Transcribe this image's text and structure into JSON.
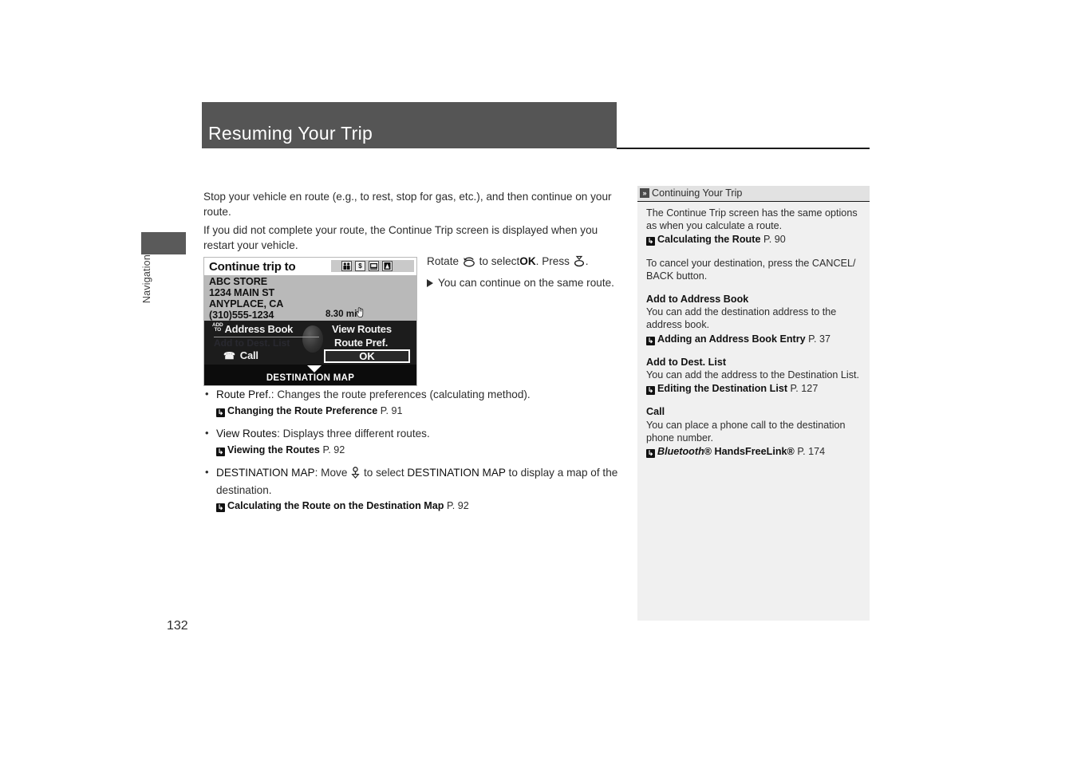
{
  "page": {
    "title": "Resuming Your Trip",
    "number": "132",
    "section_tab": "Navigation"
  },
  "main": {
    "paragraphs": [
      "Stop your vehicle en route (e.g., to rest, stop for gas, etc.), and then continue on your route.",
      "If you did not complete your route, the Continue Trip screen is displayed when you restart your vehicle."
    ],
    "callout": {
      "line_prefix": "Rotate",
      "line_middle": "to select",
      "line_ok": "OK",
      "line_press": ". Press",
      "line_end": ".",
      "sub": "You can continue on the same route."
    },
    "bullets": [
      {
        "term": "Route Pref.",
        "desc": ": Changes the route preferences (calculating method).",
        "ref_name": "Changing the Route Preference",
        "ref_page": "P. 91"
      },
      {
        "term": "View Routes",
        "desc": ": Displays three different routes.",
        "ref_name": "Viewing the Routes",
        "ref_page": "P. 92"
      },
      {
        "term": "DESTINATION MAP",
        "desc_a": ": Move",
        "desc_b": "to select",
        "desc_c": "DESTINATION MAP",
        "desc_d": "to display a map of the destination.",
        "ref_name": "Calculating the Route on the Destination Map",
        "ref_page": "P. 92"
      }
    ]
  },
  "nav_screen": {
    "title": "Continue trip to",
    "status_icons": [
      "people-icon",
      "dollar-icon",
      "screen-icon",
      "map-icon"
    ],
    "address_lines": "ABC STORE\n1234 MAIN ST\nANYPLACE, CA\n(310)555-1234",
    "distance": "8.30 mi",
    "cursor_icon": "hand-cursor-icon",
    "buttons": {
      "add_to_prefix": "ADD\nTO",
      "address_book": "Address Book",
      "dest_list_disabled": "Add to Dest. List",
      "call": "Call",
      "view_routes": "View Routes",
      "route_pref": "Route Pref.",
      "ok": "OK"
    },
    "footer": "DESTINATION MAP"
  },
  "sidebar": {
    "header": "Continuing Your Trip",
    "header_icon": "double-chevron-icon",
    "blocks": [
      {
        "text": "The Continue Trip screen has the same options as when you calculate a route.",
        "ref_name": "Calculating the Route",
        "ref_page": "P. 90"
      },
      {
        "text": "To cancel your destination, press the CANCEL/ BACK button."
      },
      {
        "head": "Add to Address Book",
        "text": "You can add the destination address to the address book.",
        "ref_name": "Adding an Address Book Entry",
        "ref_page": "P. 37"
      },
      {
        "head": "Add to Dest. List",
        "text": "You can add the address to the Destination List.",
        "ref_name": "Editing the Destination List",
        "ref_page": "P. 127"
      },
      {
        "head": "Call",
        "text": "You can place a phone call to the destination phone number.",
        "ref_name_italic": "Bluetooth",
        "ref_name_rest": "® HandsFreeLink®",
        "ref_page": "P. 174"
      }
    ]
  },
  "colors": {
    "header_band": "#555555",
    "sidebar_bg": "#f0f0f0",
    "sidebar_header_bg": "#e2e2e2",
    "text": "#2d2d2d"
  }
}
